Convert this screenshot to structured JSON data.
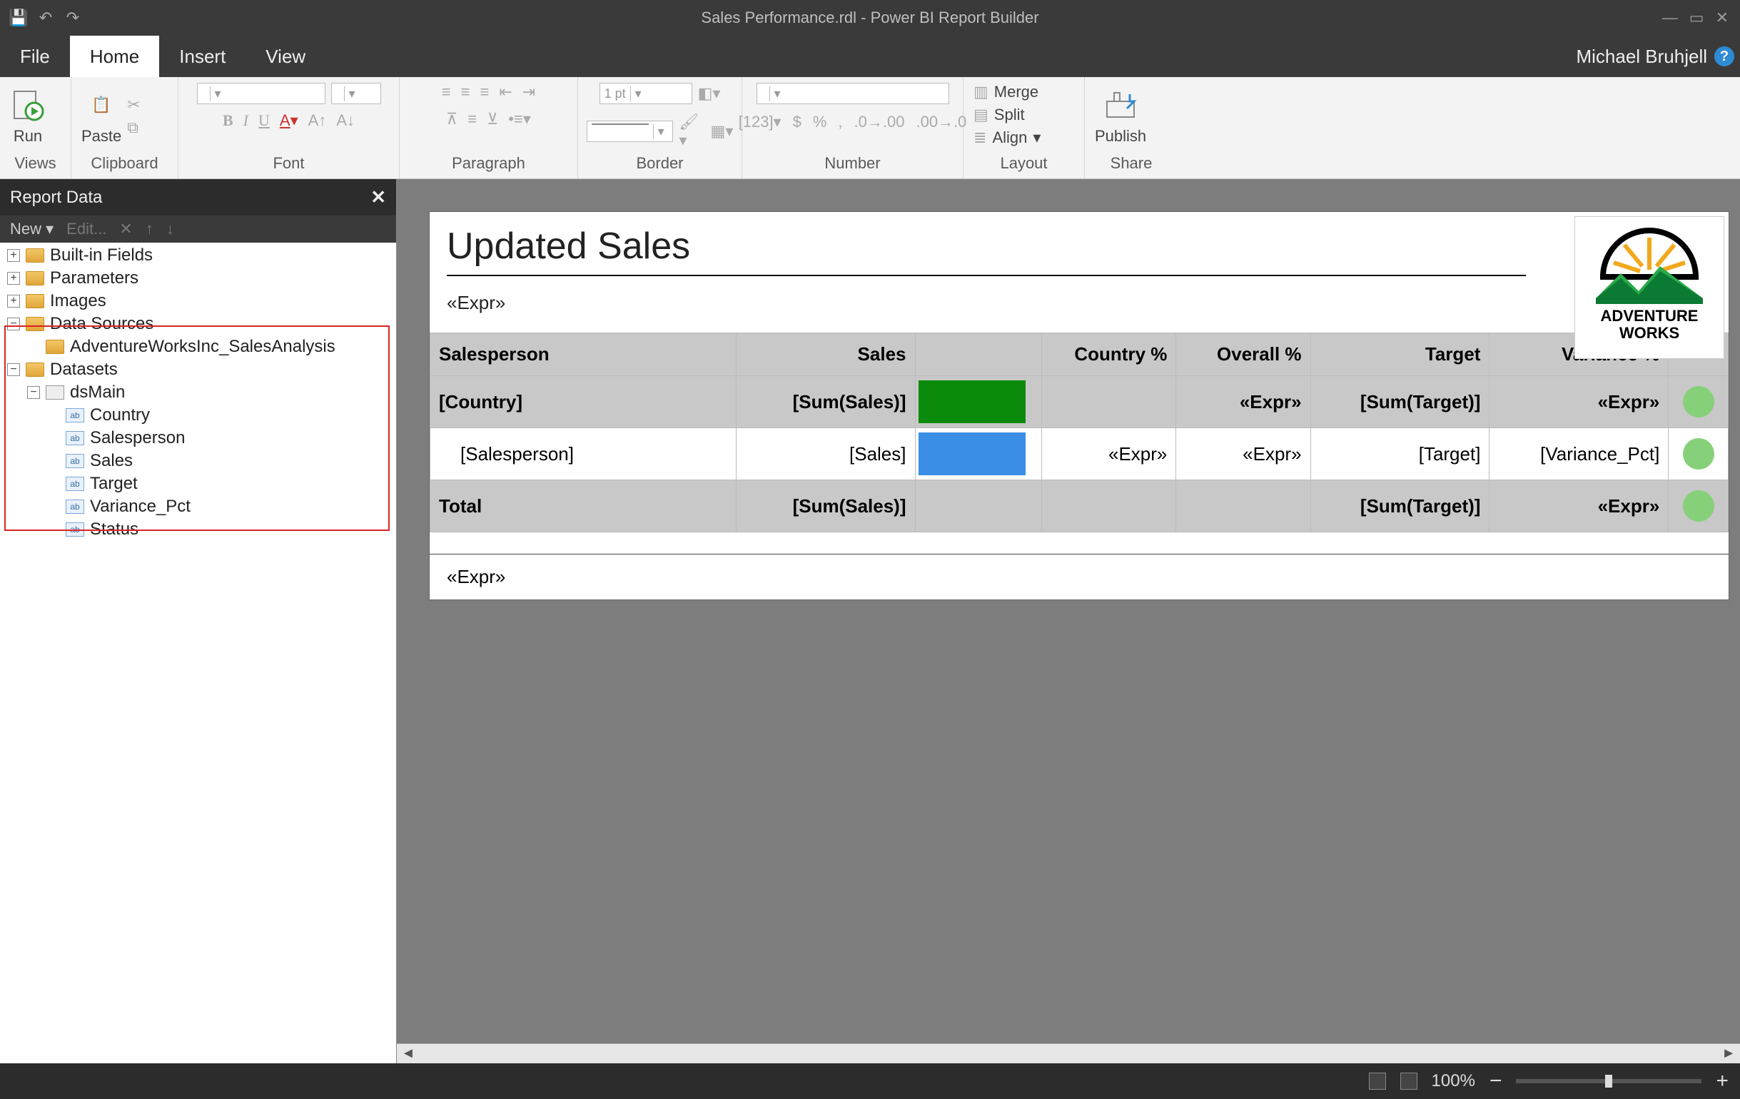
{
  "titlebar": {
    "title": "Sales Performance.rdl - Power BI Report Builder"
  },
  "menu": {
    "tabs": [
      "File",
      "Home",
      "Insert",
      "View"
    ],
    "active_index": 1,
    "user": "Michael Bruhjell"
  },
  "ribbon": {
    "run": "Run",
    "paste": "Paste",
    "publish": "Publish",
    "border_pt": "1 pt",
    "layout": {
      "merge": "Merge",
      "split": "Split",
      "align": "Align"
    },
    "groups": [
      "Views",
      "Clipboard",
      "Font",
      "Paragraph",
      "Border",
      "Number",
      "Layout",
      "Share"
    ]
  },
  "panel": {
    "title": "Report Data",
    "toolbar": {
      "new": "New",
      "edit": "Edit...",
      "delete_icon": "✕",
      "up_icon": "↑",
      "down_icon": "↓"
    },
    "nodes": {
      "builtin": "Built-in Fields",
      "params": "Parameters",
      "images": "Images",
      "datasources": "Data Sources",
      "ds_item": "AdventureWorksInc_SalesAnalysis",
      "datasets": "Datasets",
      "dsmain": "dsMain",
      "fields": [
        "Country",
        "Salesperson",
        "Sales",
        "Target",
        "Variance_Pct",
        "Status"
      ]
    }
  },
  "report": {
    "title": "Updated Sales",
    "header_expr": "«Expr»",
    "logo_top": "ADVENTURE",
    "logo_bottom": "WORKS",
    "columns": [
      "Salesperson",
      "Sales",
      "",
      "Country %",
      "Overall %",
      "Target",
      "Variance %",
      ""
    ],
    "row_country": {
      "c0": "[Country]",
      "c1": "[Sum(Sales)]",
      "c2_color": "#0b8a0b",
      "c3": "",
      "c4": "«Expr»",
      "c5": "[Sum(Target)]",
      "c6": "«Expr»"
    },
    "row_sp": {
      "c0": "[Salesperson]",
      "c1": "[Sales]",
      "c2_color": "#3a8ee6",
      "c3": "«Expr»",
      "c4": "«Expr»",
      "c5": "[Target]",
      "c6": "[Variance_Pct]"
    },
    "row_total": {
      "c0": "Total",
      "c1": "[Sum(Sales)]",
      "c2": "",
      "c3": "",
      "c4": "",
      "c5": "[Sum(Target)]",
      "c6": "«Expr»"
    },
    "footer_expr": "«Expr»"
  },
  "status": {
    "zoom": "100%"
  }
}
